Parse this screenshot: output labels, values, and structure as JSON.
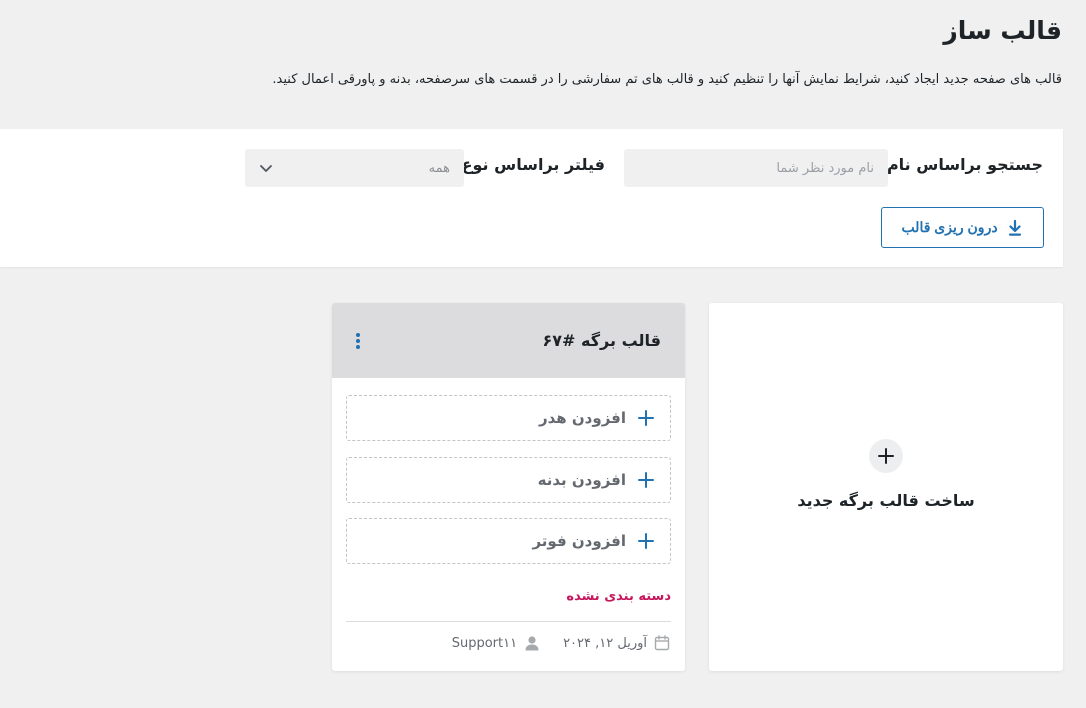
{
  "page": {
    "title": "قالب ساز",
    "description": "قالب های صفحه جدید ایجاد کنید، شرایط نمایش آنها را تنظیم کنید و قالب های تم سفارشی را در قسمت های سرصفحه، بدنه و پاورقی اعمال کنید."
  },
  "filters": {
    "search_label": "جستجو براساس نام",
    "search_placeholder": "نام مورد نظر شما",
    "search_value": "",
    "type_label": "فیلتر براساس نوع",
    "type_selected": "همه",
    "import_button": "درون ریزی قالب",
    "import_icon": "download-icon"
  },
  "create_card": {
    "label": "ساخت قالب برگه جدید",
    "icon": "plus-icon"
  },
  "template_card": {
    "title": "قالب برگه #۶۷",
    "slots": [
      {
        "label": "افزودن هدر"
      },
      {
        "label": "افزودن بدنه"
      },
      {
        "label": "افزودن فوتر"
      }
    ],
    "category": "دسته بندی نشده",
    "date": "آوریل ۱۲, ۲۰۲۴",
    "author": "Support۱۱"
  },
  "colors": {
    "accent": "#2271b1",
    "category": "#c5165b",
    "background": "#f0f0f1",
    "card_header": "#dcdcde"
  }
}
